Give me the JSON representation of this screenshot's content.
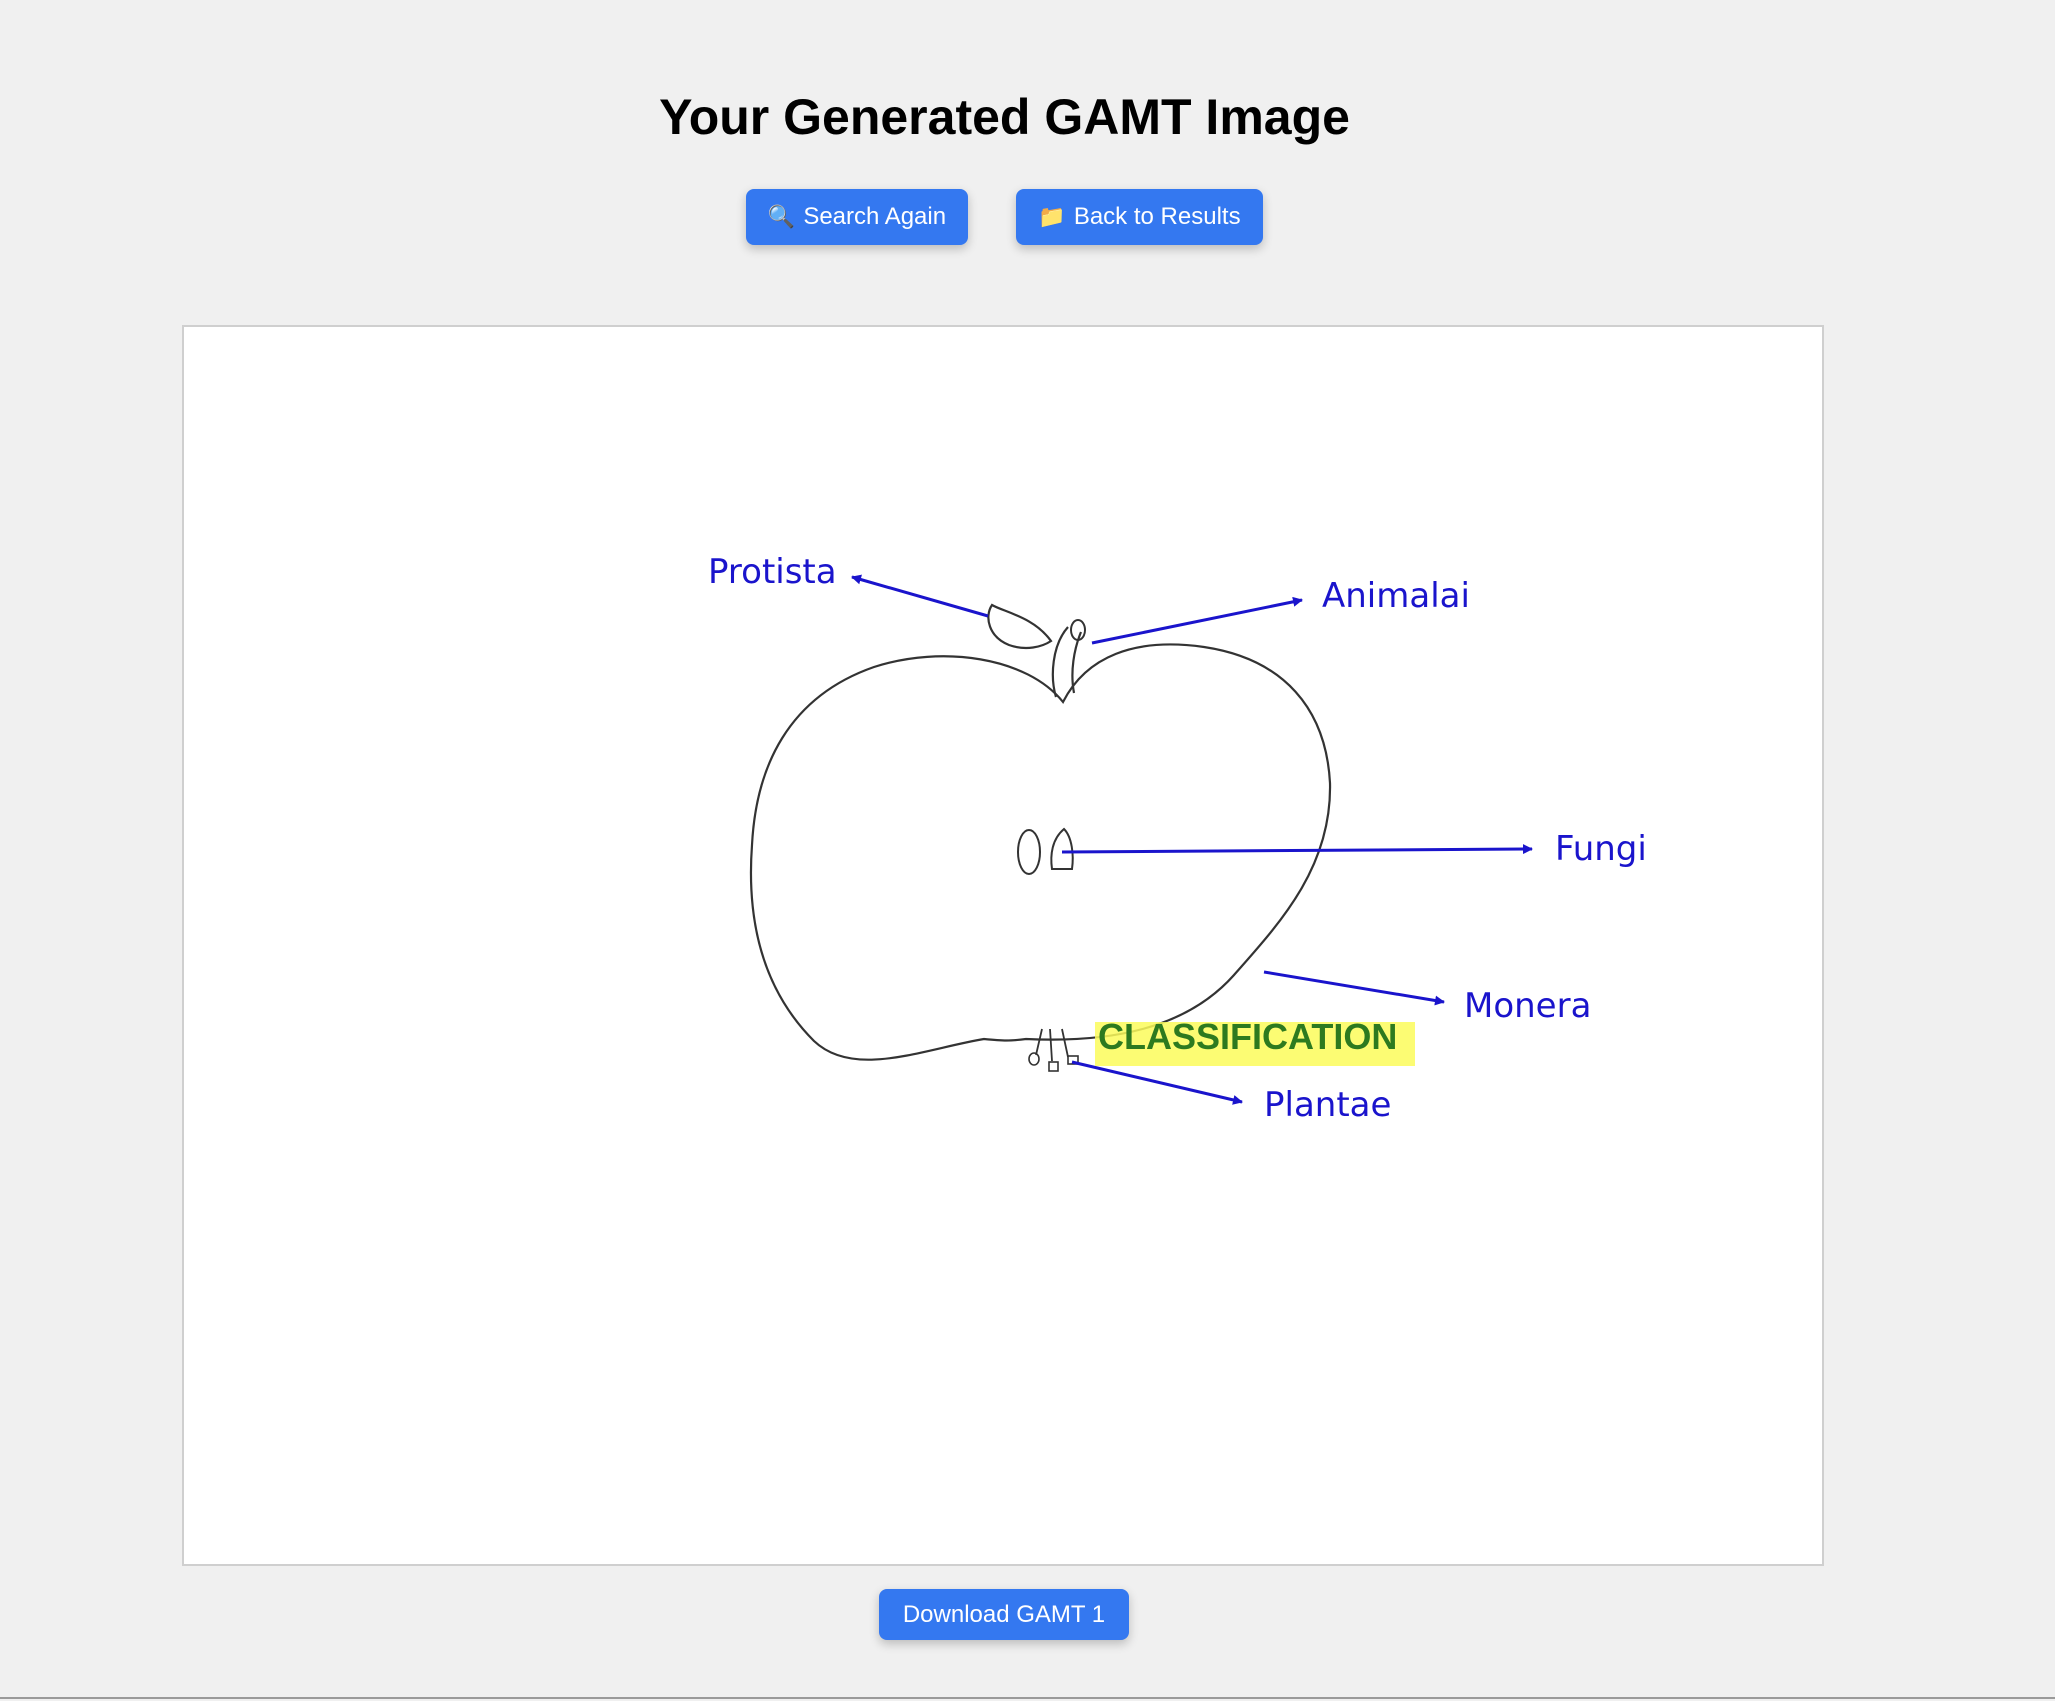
{
  "page": {
    "title": "Your Generated GAMT Image"
  },
  "toolbar": {
    "search_again": {
      "icon": "magnifier-icon",
      "glyph": "🔍",
      "label": "Search Again"
    },
    "back_to_results": {
      "icon": "folder-icon",
      "glyph": "📁",
      "label": "Back to Results"
    }
  },
  "diagram": {
    "center_label": "CLASSIFICATION",
    "labels": {
      "protista": "Protista",
      "animalai": "Animalai",
      "fungi": "Fungi",
      "monera": "Monera",
      "plantae": "Plantae"
    }
  },
  "footer": {
    "download_label": "Download GAMT 1"
  },
  "colors": {
    "background": "#f0f0f0",
    "button": "#3478f0",
    "label_text": "#1a14cc",
    "center_text": "#2d7a1f",
    "highlight": "#fbfb5a"
  }
}
